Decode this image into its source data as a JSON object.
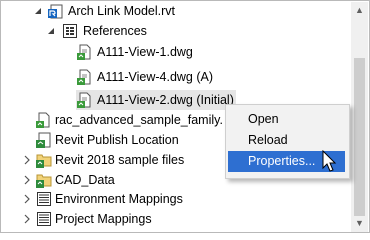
{
  "tree": {
    "items": [
      {
        "label": "Arch Link Model.rvt",
        "expanded": true,
        "icon": "revit-model-icon"
      },
      {
        "label": "References",
        "expanded": true,
        "icon": "references-folder-icon"
      },
      {
        "label": "A111-View-1.dwg",
        "icon": "dwg-file-icon"
      },
      {
        "label": "A111-View-4.dwg (A)",
        "icon": "dwg-file-icon"
      },
      {
        "label": "A111-View-2.dwg (Initial)",
        "icon": "dwg-file-icon",
        "selected": true
      },
      {
        "label": "rac_advanced_sample_family.",
        "icon": "revit-family-icon"
      },
      {
        "label": "Revit Publish Location",
        "icon": "revit-publish-icon"
      },
      {
        "label": "Revit 2018 sample files",
        "expanded": false,
        "icon": "revit-folder-icon"
      },
      {
        "label": "CAD_Data",
        "expanded": false,
        "icon": "cad-folder-icon"
      },
      {
        "label": "Environment Mappings",
        "expanded": false,
        "icon": "mappings-icon"
      },
      {
        "label": "Project Mappings",
        "expanded": false,
        "icon": "mappings-icon"
      }
    ]
  },
  "context_menu": {
    "items": [
      {
        "label": "Open"
      },
      {
        "label": "Reload"
      },
      {
        "label": "Properties...",
        "highlighted": true
      }
    ]
  },
  "colors": {
    "selection": "#e5e5e5",
    "menu_highlight": "#2e6fd1",
    "menu_background": "#f2f2f2"
  }
}
